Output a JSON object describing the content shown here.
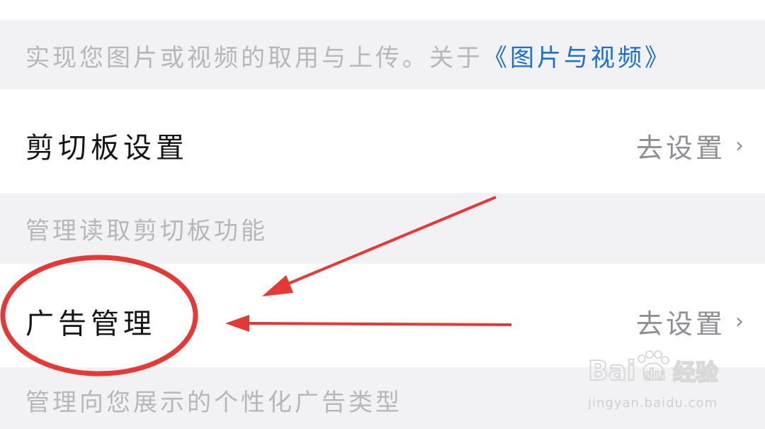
{
  "media_section": {
    "description": "实现您图片或视频的取用与上传。关于",
    "link_label": "《图片与视频》"
  },
  "clipboard": {
    "title": "剪切板设置",
    "action_label": "去设置",
    "description": "管理读取剪切板功能"
  },
  "ads": {
    "title": "广告管理",
    "action_label": "去设置",
    "description": "管理向您展示的个性化广告类型"
  },
  "icons": {
    "chevron": "chevron-right-icon"
  },
  "watermark": {
    "brand_a": "Bai",
    "brand_b": "du",
    "brand_cn": "经验",
    "url": "jingyan.baidu.com"
  },
  "colors": {
    "link": "#1a6fd6",
    "annotation": "#e53935",
    "background": "#f2f2f4"
  }
}
